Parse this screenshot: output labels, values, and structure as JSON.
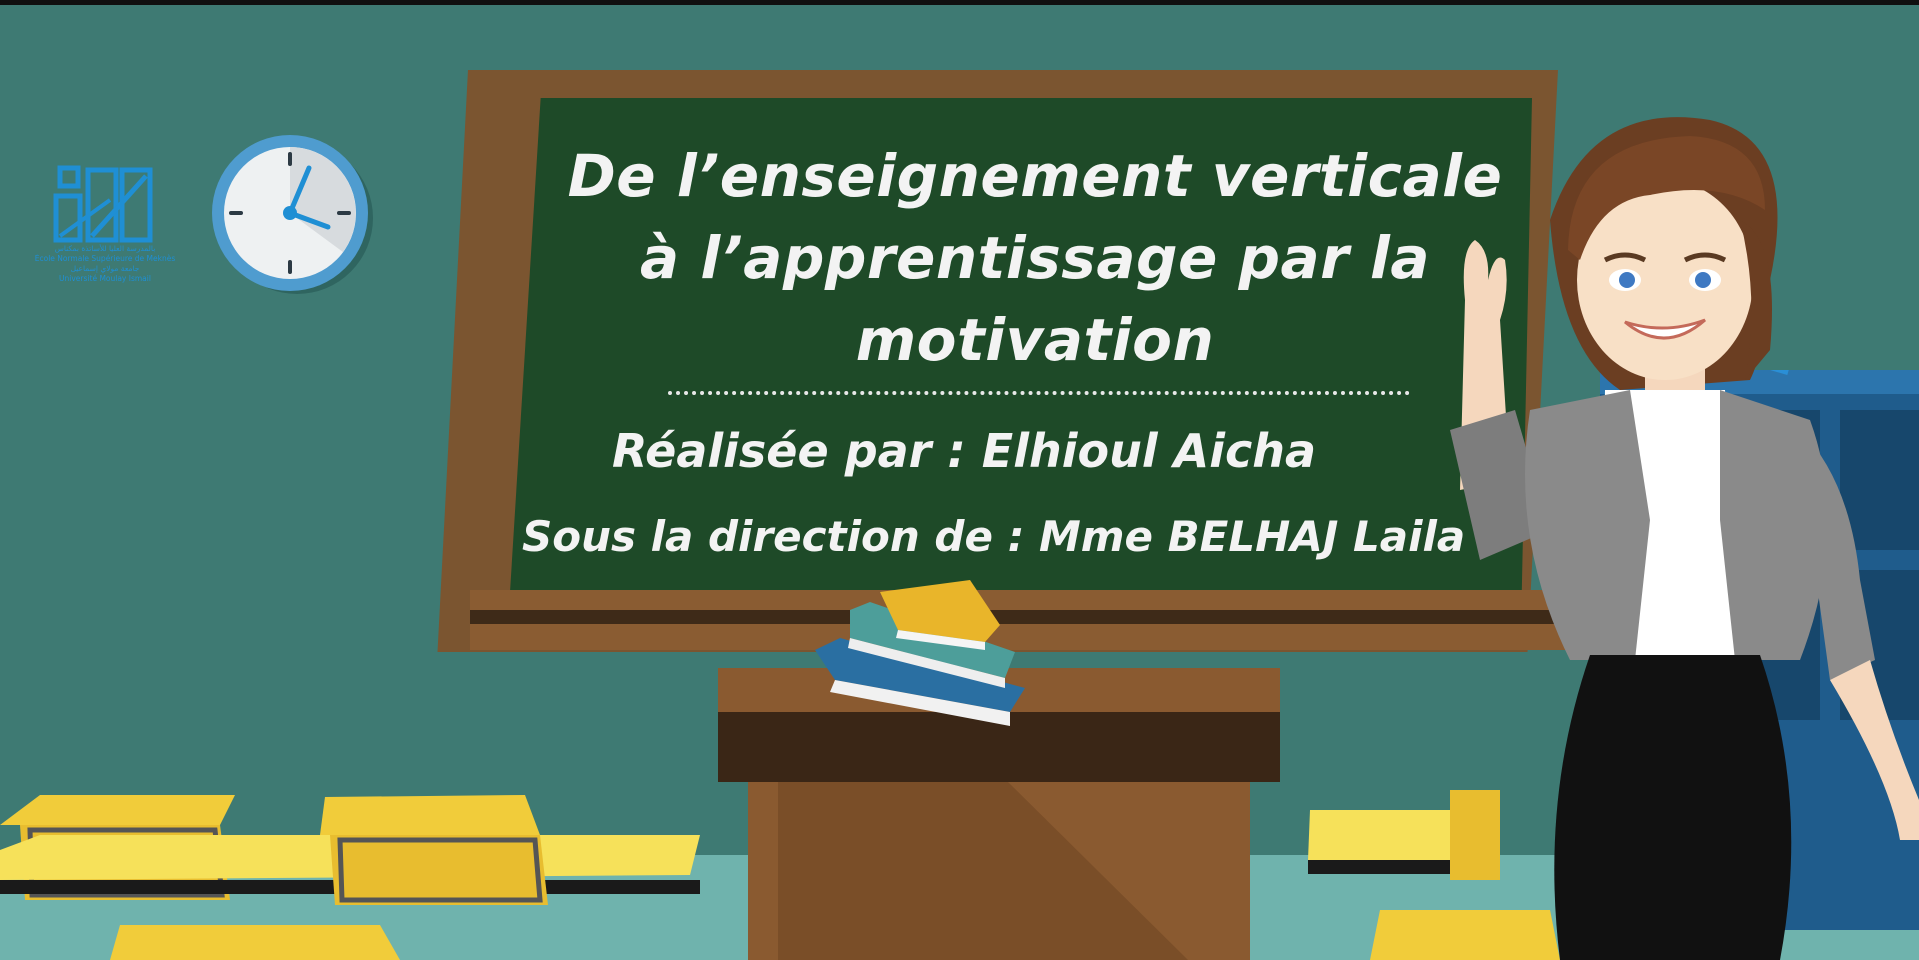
{
  "slide": {
    "title_lines": [
      "De l’enseignement verticale",
      "à l’apprentissage par la",
      "motivation"
    ],
    "author_line": "Réalisée par : Elhioul Aicha",
    "supervisor_line": "Sous la direction de : Mme BELHAJ Laila"
  },
  "logo": {
    "lines": [
      "بالمدرسة العليا للأساتذة بمكناس",
      "École Normale Supérieure de Meknès",
      "جامعة مولاي إسماعيل",
      "Université Moulay Ismail"
    ]
  },
  "clock": {
    "hour": 4,
    "minute": 2
  },
  "colors": {
    "wall": "#3e7a73",
    "board": "#1e4a28",
    "frame": "#7b5530",
    "chalk": "#f3f3f3",
    "desk_yellow": "#f1cc3a",
    "logo_blue": "#1f8fd4"
  }
}
